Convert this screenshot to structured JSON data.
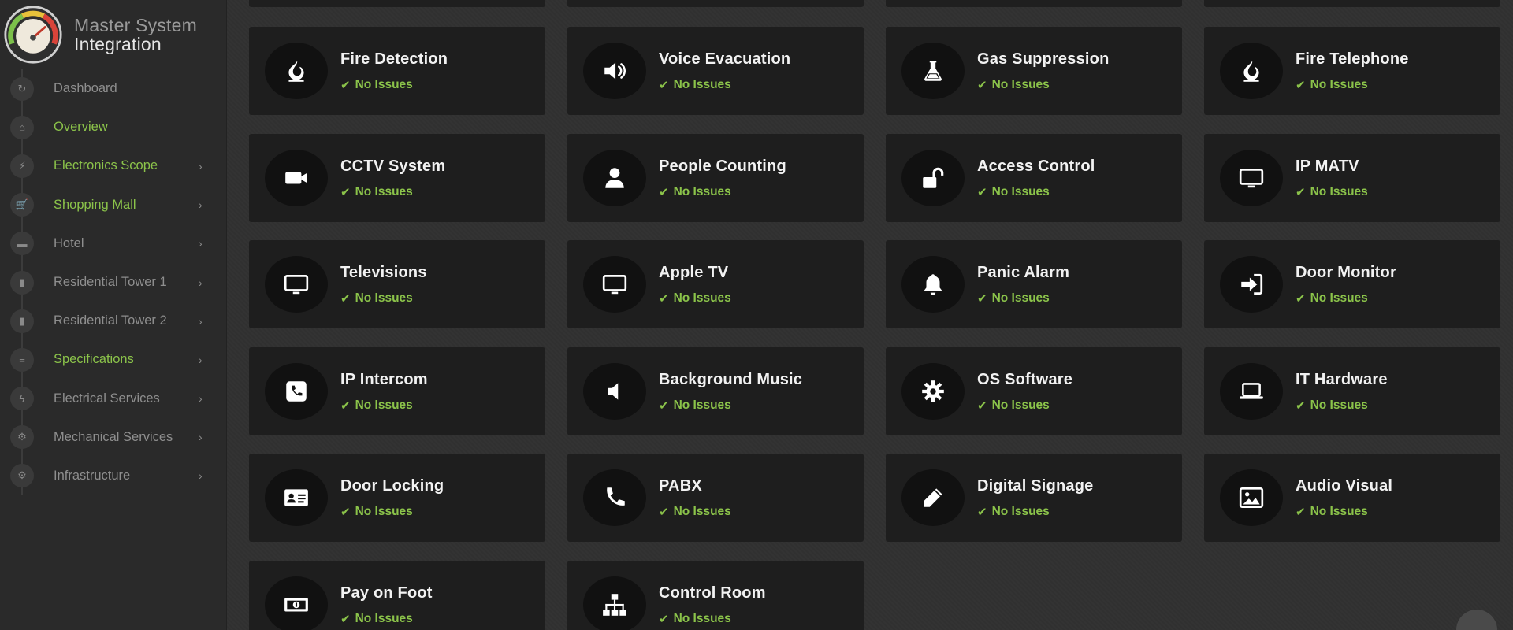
{
  "brand": {
    "line1": "Master System",
    "line2": "Integration"
  },
  "sidebar": {
    "items": [
      {
        "label": "Dashboard",
        "icon": "↻",
        "green": false,
        "chevron": false
      },
      {
        "label": "Overview",
        "icon": "⌂",
        "green": true,
        "chevron": false
      },
      {
        "label": "Electronics Scope",
        "icon": "⚡",
        "green": true,
        "chevron": true
      },
      {
        "label": "Shopping Mall",
        "icon": "🛒",
        "green": true,
        "chevron": true
      },
      {
        "label": "Hotel",
        "icon": "▬",
        "green": false,
        "chevron": true
      },
      {
        "label": "Residential Tower 1",
        "icon": "▮",
        "green": false,
        "chevron": true
      },
      {
        "label": "Residential Tower 2",
        "icon": "▮",
        "green": false,
        "chevron": true
      },
      {
        "label": "Specifications",
        "icon": "≡",
        "green": true,
        "chevron": true
      },
      {
        "label": "Electrical Services",
        "icon": "ϟ",
        "green": false,
        "chevron": true
      },
      {
        "label": "Mechanical Services",
        "icon": "⚙",
        "green": false,
        "chevron": true
      },
      {
        "label": "Infrastructure",
        "icon": "⚙",
        "green": false,
        "chevron": true
      }
    ],
    "chevron": "›"
  },
  "status_text": "No Issues",
  "colors": {
    "accent_green": "#8bc34a",
    "tile_bg": "#1e1e1e",
    "sidebar_bg": "#2a2a2a"
  },
  "tiles": [
    {
      "title": "Fire Detection",
      "icon": "fire"
    },
    {
      "title": "Voice Evacuation",
      "icon": "speaker-loud"
    },
    {
      "title": "Gas Suppression",
      "icon": "flask"
    },
    {
      "title": "Fire Telephone",
      "icon": "fire"
    },
    {
      "title": "CCTV System",
      "icon": "video-camera"
    },
    {
      "title": "People Counting",
      "icon": "user"
    },
    {
      "title": "Access Control",
      "icon": "unlock"
    },
    {
      "title": "IP MATV",
      "icon": "monitor"
    },
    {
      "title": "Televisions",
      "icon": "monitor"
    },
    {
      "title": "Apple TV",
      "icon": "monitor"
    },
    {
      "title": "Panic Alarm",
      "icon": "bell"
    },
    {
      "title": "Door Monitor",
      "icon": "sign-in"
    },
    {
      "title": "IP Intercom",
      "icon": "phone-square"
    },
    {
      "title": "Background Music",
      "icon": "speaker-off"
    },
    {
      "title": "OS Software",
      "icon": "gear"
    },
    {
      "title": "IT Hardware",
      "icon": "laptop"
    },
    {
      "title": "Door Locking",
      "icon": "id-card"
    },
    {
      "title": "PABX",
      "icon": "phone"
    },
    {
      "title": "Digital Signage",
      "icon": "pencil"
    },
    {
      "title": "Audio Visual",
      "icon": "image"
    },
    {
      "title": "Pay on Foot",
      "icon": "money"
    },
    {
      "title": "Control Room",
      "icon": "sitemap"
    }
  ]
}
